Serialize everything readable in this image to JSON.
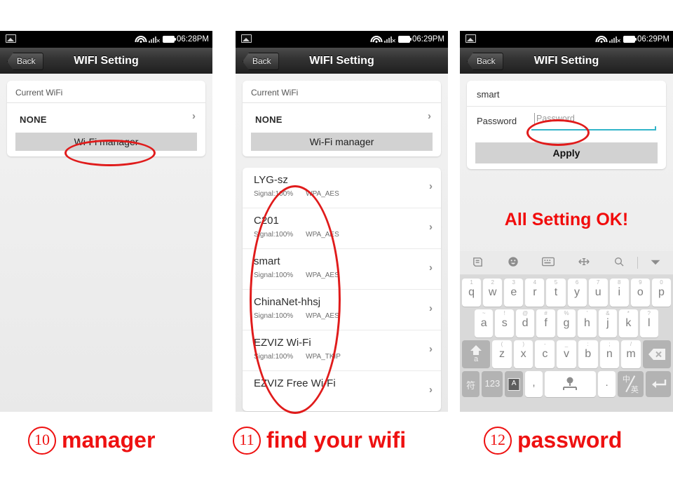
{
  "page": {
    "accent_red": "#ee1111",
    "underline_cyan": "#33b5c9"
  },
  "panels": [
    {
      "status": {
        "time": "06:28PM",
        "wifi_icon": "wifi-icon",
        "signal_icon": "signal-no-service-icon",
        "battery_icon": "battery-icon",
        "photo_icon": "photo-notification-icon"
      },
      "titlebar": {
        "back_label": "Back",
        "title": "WIFI Setting"
      },
      "card": {
        "section_label": "Current WiFi",
        "current_value": "NONE",
        "chevron": "chevron-right-icon",
        "manager_button": "Wi-Fi manager"
      }
    },
    {
      "status": {
        "time": "06:29PM",
        "wifi_icon": "wifi-icon",
        "signal_icon": "signal-no-service-icon",
        "battery_icon": "battery-icon",
        "photo_icon": "photo-notification-icon"
      },
      "titlebar": {
        "back_label": "Back",
        "title": "WIFI Setting"
      },
      "card": {
        "section_label": "Current WiFi",
        "current_value": "NONE",
        "chevron": "chevron-right-icon",
        "manager_button": "Wi-Fi manager"
      },
      "networks": [
        {
          "ssid": "LYG-sz",
          "signal": "Signal:100%",
          "security": "WPA_AES"
        },
        {
          "ssid": "C201",
          "signal": "Signal:100%",
          "security": "WPA_AES"
        },
        {
          "ssid": "smart",
          "signal": "Signal:100%",
          "security": "WPA_AES"
        },
        {
          "ssid": "ChinaNet-hhsj",
          "signal": "Signal:100%",
          "security": "WPA_AES"
        },
        {
          "ssid": "EZVIZ Wi-Fi",
          "signal": "Signal:100%",
          "security": "WPA_TKIP"
        },
        {
          "ssid": "EZVIZ Free Wi-Fi",
          "signal": "",
          "security": ""
        }
      ]
    },
    {
      "status": {
        "time": "06:29PM",
        "wifi_icon": "wifi-icon",
        "signal_icon": "signal-no-service-icon",
        "battery_icon": "battery-icon",
        "photo_icon": "photo-notification-icon"
      },
      "titlebar": {
        "back_label": "Back",
        "title": "WIFI Setting"
      },
      "form": {
        "ssid_value": "smart",
        "password_label": "Password",
        "password_placeholder": "Password",
        "password_value": "",
        "apply_button": "Apply"
      },
      "message": "All Setting OK!",
      "keyboard": {
        "toolbar": [
          {
            "name": "sogou-logo-icon",
            "glyph": "ᴘ"
          },
          {
            "name": "emoji-icon",
            "glyph": "☺"
          },
          {
            "name": "keyboard-icon",
            "glyph": "⌨"
          },
          {
            "name": "cursor-move-icon",
            "glyph": "⬌"
          },
          {
            "name": "search-icon",
            "glyph": "⌕"
          },
          {
            "name": "chevron-down-icon",
            "glyph": "▼"
          }
        ],
        "row1": [
          {
            "main": "q",
            "sup": "1"
          },
          {
            "main": "w",
            "sup": "2"
          },
          {
            "main": "e",
            "sup": "3"
          },
          {
            "main": "r",
            "sup": "4"
          },
          {
            "main": "t",
            "sup": "5"
          },
          {
            "main": "y",
            "sup": "6"
          },
          {
            "main": "u",
            "sup": "7"
          },
          {
            "main": "i",
            "sup": "8"
          },
          {
            "main": "o",
            "sup": "9"
          },
          {
            "main": "p",
            "sup": "0"
          }
        ],
        "row2": [
          {
            "main": "a",
            "sup": "~"
          },
          {
            "main": "s",
            "sup": "!"
          },
          {
            "main": "d",
            "sup": "@"
          },
          {
            "main": "f",
            "sup": "#"
          },
          {
            "main": "g",
            "sup": "%"
          },
          {
            "main": "h",
            "sup": "'"
          },
          {
            "main": "j",
            "sup": "&"
          },
          {
            "main": "k",
            "sup": "*"
          },
          {
            "main": "l",
            "sup": "?"
          }
        ],
        "row3": [
          {
            "main": "z",
            "sup": "("
          },
          {
            "main": "x",
            "sup": ")"
          },
          {
            "main": "c",
            "sup": "-"
          },
          {
            "main": "v",
            "sup": "_"
          },
          {
            "main": "b",
            "sup": ":"
          },
          {
            "main": "n",
            "sup": ";"
          },
          {
            "main": "m",
            "sup": "/"
          }
        ],
        "shift_key": "shift-icon",
        "backspace_key": "backspace-icon",
        "row4": {
          "symbol": "符",
          "numbers": "123",
          "abc_mode": "A",
          "comma": ",",
          "space": "space-mic-icon",
          "period": ".",
          "lang_toggle_top": "中",
          "lang_toggle_bottom": "英",
          "enter": "enter-icon"
        }
      }
    }
  ],
  "captions": [
    {
      "number": "10",
      "text": "manager"
    },
    {
      "number": "11",
      "text": "find  your wifi"
    },
    {
      "number": "12",
      "text": "password"
    }
  ]
}
